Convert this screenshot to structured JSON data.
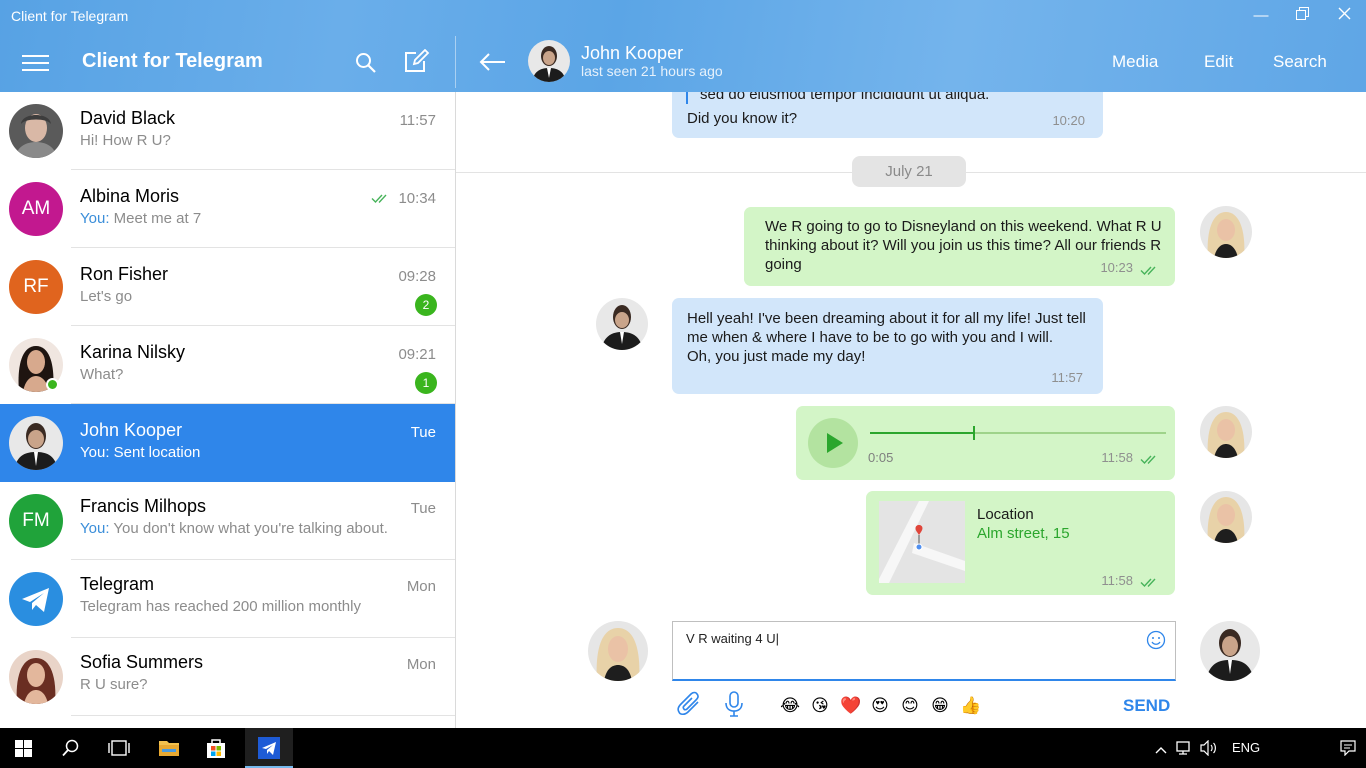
{
  "window": {
    "title": "Client for Telegram"
  },
  "header": {
    "app_title": "Client for Telegram",
    "chat_name": "John Kooper",
    "chat_status": "last seen 21 hours ago",
    "actions": [
      "Media",
      "Edit",
      "Search"
    ]
  },
  "dialogs": [
    {
      "name": "David Black",
      "preview": "Hi! How R U?",
      "you_prefix": "",
      "time": "11:57",
      "initials": "",
      "avatar_color": "#6b6b6b",
      "badge": "",
      "read": false,
      "online": false,
      "selected": false
    },
    {
      "name": "Albina Moris",
      "preview": "Meet me at 7",
      "you_prefix": "You: ",
      "time": "10:34",
      "initials": "AM",
      "avatar_color": "#c2188f",
      "badge": "",
      "read": true,
      "online": false,
      "selected": false
    },
    {
      "name": "Ron Fisher",
      "preview": "Let's go",
      "you_prefix": "",
      "time": "09:28",
      "initials": "RF",
      "avatar_color": "#e0641e",
      "badge": "2",
      "read": false,
      "online": false,
      "selected": false
    },
    {
      "name": "Karina Nilsky",
      "preview": "What?",
      "you_prefix": "",
      "time": "09:21",
      "initials": "",
      "avatar_color": "#4a3a36",
      "badge": "1",
      "read": false,
      "online": true,
      "selected": false
    },
    {
      "name": "John Kooper",
      "preview": "Sent location",
      "you_prefix": "You: ",
      "time": "Tue",
      "initials": "",
      "avatar_color": "#2a2a2a",
      "badge": "",
      "read": false,
      "online": false,
      "selected": true
    },
    {
      "name": "Francis Milhops",
      "preview": "You don't know what you're talking about.",
      "you_prefix": "You: ",
      "time": "Tue",
      "initials": "FM",
      "avatar_color": "#20a33a",
      "badge": "",
      "read": false,
      "online": false,
      "selected": false
    },
    {
      "name": "Telegram",
      "preview": "Telegram has reached 200 million monthly",
      "you_prefix": "",
      "time": "Mon",
      "initials": "",
      "avatar_color": "#2a8ee0",
      "badge": "",
      "read": false,
      "online": false,
      "selected": false
    },
    {
      "name": "Sofia Summers",
      "preview": "R U sure?",
      "you_prefix": "",
      "time": "Mon",
      "initials": "",
      "avatar_color": "#7a3b35",
      "badge": "",
      "read": false,
      "online": false,
      "selected": false
    }
  ],
  "messages": {
    "quoted_text": "sed do eiusmod tempor incididunt ut aliqua.",
    "msg1_text": "Did you know it?",
    "msg1_time": "10:20",
    "date_separator": "July 21",
    "msg2_text": "We R going to go to Disneyland on this weekend. What R U thinking about it? Will you join us this time? All our friends R going",
    "msg2_time": "10:23",
    "msg3_text": "Hell yeah! I've been dreaming about it for all my life! Just tell me when & where I have to be to go with you and I will.\nOh, you just made my day!",
    "msg3_time": "11:57",
    "voice_duration": "0:05",
    "voice_progress": 0.35,
    "msg4_time": "11:58",
    "location_title": "Location",
    "location_address": "Alm street, 15",
    "msg5_time": "11:58"
  },
  "composer": {
    "text": "V R waiting 4 U|",
    "send_label": "SEND",
    "emojis": [
      "😂",
      "😘",
      "❤️",
      "😍",
      "😊",
      "😁",
      "👍"
    ]
  },
  "taskbar": {
    "language": "ENG"
  },
  "colors": {
    "accent": "#2f86ea",
    "incoming_bubble": "#d2e6fa",
    "outgoing_bubble": "#d3f5c7",
    "badge": "#3ab51e"
  }
}
